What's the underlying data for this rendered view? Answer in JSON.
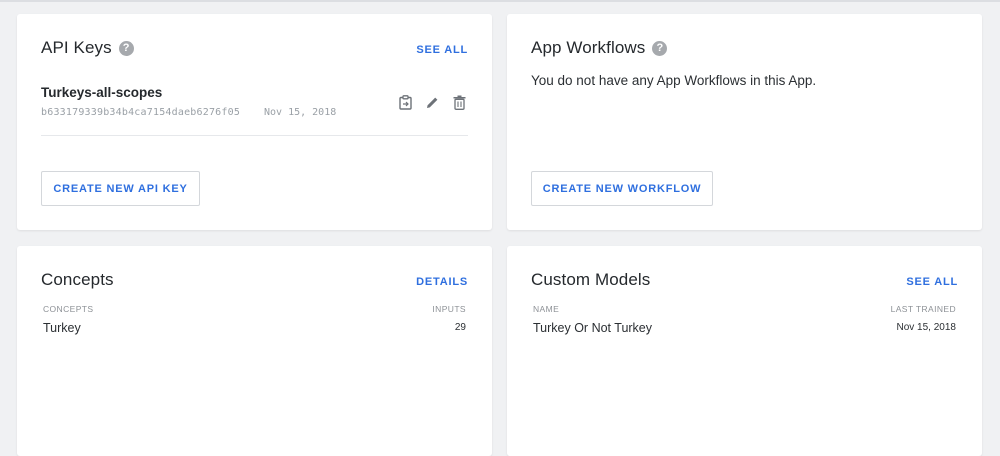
{
  "api_keys": {
    "title": "API Keys",
    "see_all": "SEE ALL",
    "key_name": "Turkeys-all-scopes",
    "key_hash": "b633179339b34b4ca7154daeb6276f05",
    "key_date": "Nov 15, 2018",
    "icons": [
      "clipboard-icon",
      "pencil-icon",
      "trash-icon"
    ],
    "create_button": "CREATE NEW API KEY"
  },
  "app_workflows": {
    "title": "App Workflows",
    "empty_message": "You do not have any App Workflows in this App.",
    "create_button": "CREATE NEW WORKFLOW"
  },
  "concepts": {
    "title": "Concepts",
    "details": "DETAILS",
    "columns": [
      "CONCEPTS",
      "INPUTS"
    ],
    "rows": [
      {
        "name": "Turkey",
        "inputs": "29"
      }
    ]
  },
  "custom_models": {
    "title": "Custom Models",
    "see_all": "SEE ALL",
    "columns": [
      "NAME",
      "LAST TRAINED"
    ],
    "rows": [
      {
        "name": "Turkey Or Not Turkey",
        "last_trained": "Nov 15, 2018"
      }
    ]
  },
  "colors": {
    "accent": "#2f6fdf",
    "background": "#f0f1f3",
    "card": "#ffffff"
  }
}
